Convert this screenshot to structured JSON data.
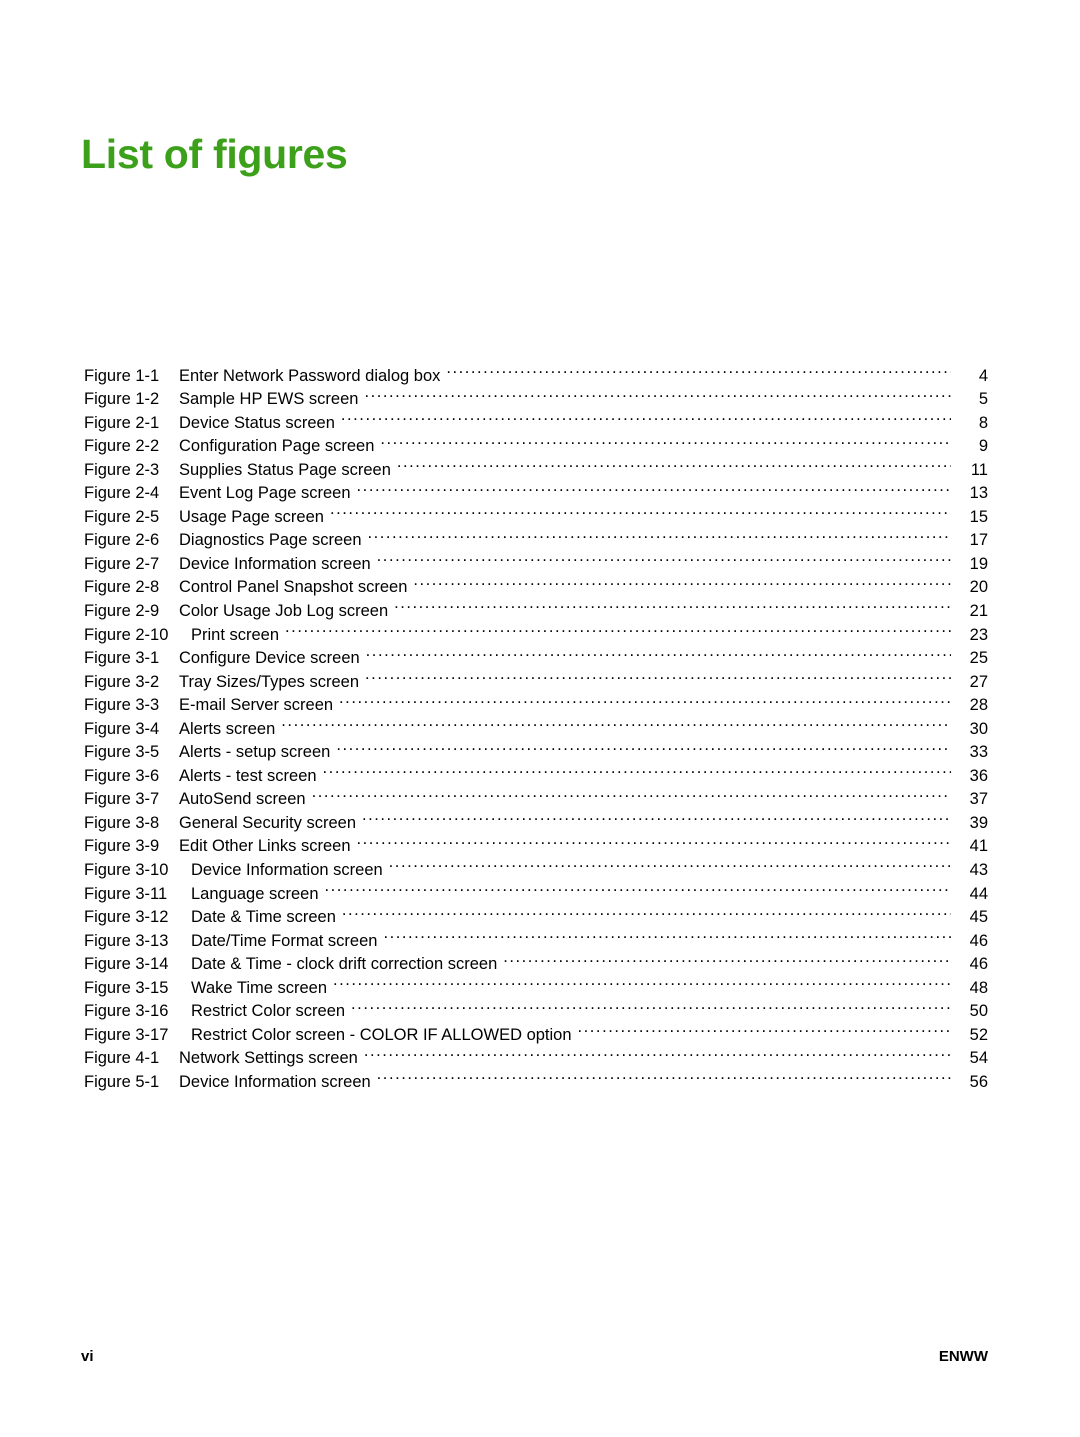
{
  "heading": {
    "text": "List of figures",
    "color": "#3da01b"
  },
  "footer": {
    "page_number": "vi",
    "doc_code": "ENWW"
  },
  "figures": [
    {
      "label": "Figure 1-1",
      "title": "Enter Network Password dialog box",
      "page": "4"
    },
    {
      "label": "Figure 1-2",
      "title": "Sample HP EWS screen",
      "page": "5"
    },
    {
      "label": "Figure 2-1",
      "title": "Device Status screen",
      "page": "8"
    },
    {
      "label": "Figure 2-2",
      "title": "Configuration Page screen",
      "page": "9"
    },
    {
      "label": "Figure 2-3",
      "title": "Supplies Status Page screen",
      "page": "11"
    },
    {
      "label": "Figure 2-4",
      "title": "Event Log Page screen",
      "page": "13"
    },
    {
      "label": "Figure 2-5",
      "title": "Usage Page screen",
      "page": "15"
    },
    {
      "label": "Figure 2-6",
      "title": "Diagnostics Page screen",
      "page": "17"
    },
    {
      "label": "Figure 2-7",
      "title": "Device Information screen",
      "page": "19"
    },
    {
      "label": "Figure 2-8",
      "title": "Control Panel Snapshot screen",
      "page": "20"
    },
    {
      "label": "Figure 2-9",
      "title": "Color Usage Job Log screen",
      "page": "21"
    },
    {
      "label": "Figure 2-10",
      "title": "Print screen",
      "page": "23"
    },
    {
      "label": "Figure 3-1",
      "title": "Configure Device screen",
      "page": "25"
    },
    {
      "label": "Figure 3-2",
      "title": "Tray Sizes/Types screen",
      "page": "27"
    },
    {
      "label": "Figure 3-3",
      "title": "E-mail Server screen",
      "page": "28"
    },
    {
      "label": "Figure 3-4",
      "title": "Alerts screen",
      "page": "30"
    },
    {
      "label": "Figure 3-5",
      "title": "Alerts - setup screen",
      "page": "33"
    },
    {
      "label": "Figure 3-6",
      "title": "Alerts - test screen",
      "page": "36"
    },
    {
      "label": "Figure 3-7",
      "title": "AutoSend screen",
      "page": "37"
    },
    {
      "label": "Figure 3-8",
      "title": "General Security screen",
      "page": "39"
    },
    {
      "label": "Figure 3-9",
      "title": "Edit Other Links screen",
      "page": "41"
    },
    {
      "label": "Figure 3-10",
      "title": "Device Information screen",
      "page": "43"
    },
    {
      "label": "Figure 3-11",
      "title": "Language screen",
      "page": "44"
    },
    {
      "label": "Figure 3-12",
      "title": "Date & Time screen",
      "page": "45"
    },
    {
      "label": "Figure 3-13",
      "title": "Date/Time Format screen",
      "page": "46"
    },
    {
      "label": "Figure 3-14",
      "title": "Date & Time - clock drift correction screen",
      "page": "46"
    },
    {
      "label": "Figure 3-15",
      "title": "Wake Time screen",
      "page": "48"
    },
    {
      "label": "Figure 3-16",
      "title": "Restrict Color screen",
      "page": "50"
    },
    {
      "label": "Figure 3-17",
      "title": "Restrict Color screen - COLOR IF ALLOWED option",
      "page": "52"
    },
    {
      "label": "Figure 4-1",
      "title": "Network Settings screen",
      "page": "54"
    },
    {
      "label": "Figure 5-1",
      "title": "Device Information screen",
      "page": "56"
    }
  ]
}
